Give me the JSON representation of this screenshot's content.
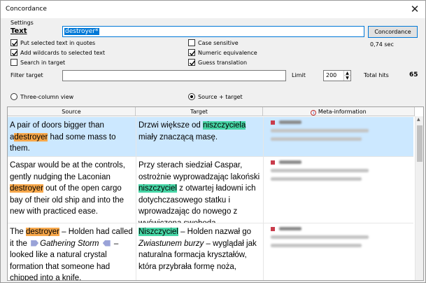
{
  "window": {
    "title": "Concordance",
    "close_glyph": "✕"
  },
  "settings": {
    "group_label": "Settings",
    "text_label": "Text",
    "text_value": "destroyer*",
    "button_label": "Concordance",
    "time": "0,74 sec",
    "checkboxes": {
      "put_selected": {
        "label": "Put selected text in quotes",
        "checked": true
      },
      "add_wildcards": {
        "label": "Add wildcards to selected text",
        "checked": true
      },
      "search_target": {
        "label": "Search in target",
        "checked": false
      },
      "case_sensitive": {
        "label": "Case sensitive",
        "checked": false
      },
      "numeric_equivalence": {
        "label": "Numeric equivalence",
        "checked": true
      },
      "guess_translation": {
        "label": "Guess translation",
        "checked": true
      }
    },
    "filter_label": "Filter target",
    "filter_value": "",
    "limit_label": "Limit",
    "limit_value": "200",
    "total_hits_label": "Total hits",
    "total_hits_value": "65"
  },
  "view": {
    "three_column": "Three-column view",
    "source_target": "Source + target",
    "selected": "source_target"
  },
  "grid": {
    "headers": {
      "source": "Source",
      "target": "Target",
      "meta": "Meta-information"
    },
    "rows": [
      {
        "source": [
          [
            "A pair of doors bigger than a",
            ""
          ],
          [
            "destroyer",
            "o"
          ],
          [
            " had some mass to them.",
            ""
          ]
        ],
        "target": [
          [
            "Drzwi większe od ",
            ""
          ],
          [
            "niszczyciela",
            "g"
          ],
          [
            " miały znaczącą masę.",
            ""
          ]
        ]
      },
      {
        "source": [
          [
            "Caspar would be at the controls, gently nudging the Laconian ",
            ""
          ],
          [
            "destroyer",
            "o"
          ],
          [
            " out of the open cargo bay of their old ship and into the new with practiced ease.",
            ""
          ]
        ],
        "target": [
          [
            "Przy sterach siedział Caspar, ostrożnie wyprowadzając lakoński ",
            ""
          ],
          [
            "niszczyciel",
            "g"
          ],
          [
            " z otwartej ładowni ich dotychczasowego statku i wprowadzając do nowego z wyćwiczoną swobodą.",
            ""
          ]
        ]
      },
      {
        "source": [
          [
            "The ",
            ""
          ],
          [
            "destroyer",
            "o"
          ],
          [
            " – Holden had called it the ",
            ""
          ],
          [
            "",
            "tag"
          ],
          [
            "Gathering Storm",
            "i"
          ],
          [
            " ",
            ""
          ],
          [
            "",
            "tagl"
          ],
          [
            " – looked like a natural crystal formation that someone had chipped into a knife.",
            ""
          ]
        ],
        "target": [
          [
            "Niszczyciel",
            "g"
          ],
          [
            " – Holden nazwał go ",
            ""
          ],
          [
            "Zwiastunem burzy",
            "i"
          ],
          [
            " – wyglądał jak naturalna formacja kryształów, która przybrała formę noża,",
            ""
          ]
        ]
      }
    ]
  }
}
